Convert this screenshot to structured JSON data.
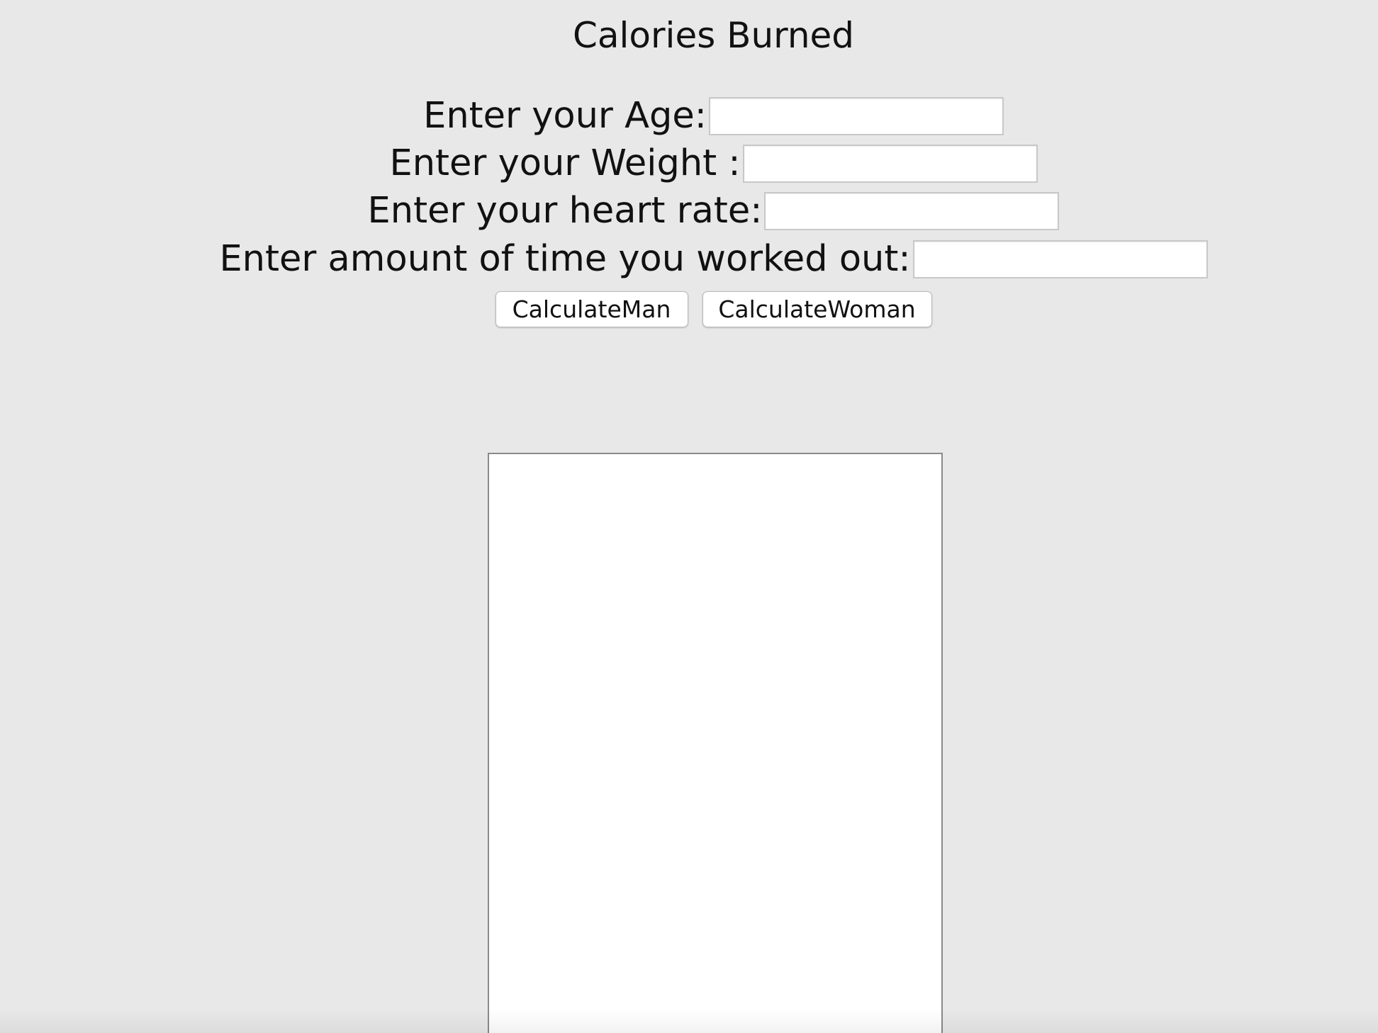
{
  "page": {
    "title": "Calories Burned"
  },
  "form": {
    "age_label": "Enter your Age:",
    "age_value": "",
    "weight_label": "Enter your Weight :",
    "weight_value": "",
    "heart_rate_label": "Enter your heart rate:",
    "heart_rate_value": "",
    "time_label": "Enter amount of time you worked out:",
    "time_value": ""
  },
  "buttons": {
    "calculate_man": "CalculateMan",
    "calculate_woman": "CalculateWoman"
  },
  "result": {
    "text": ""
  },
  "colors": {
    "background": "#e8e8e8",
    "field_background": "#ffffff",
    "result_border": "#8a8a8a"
  }
}
